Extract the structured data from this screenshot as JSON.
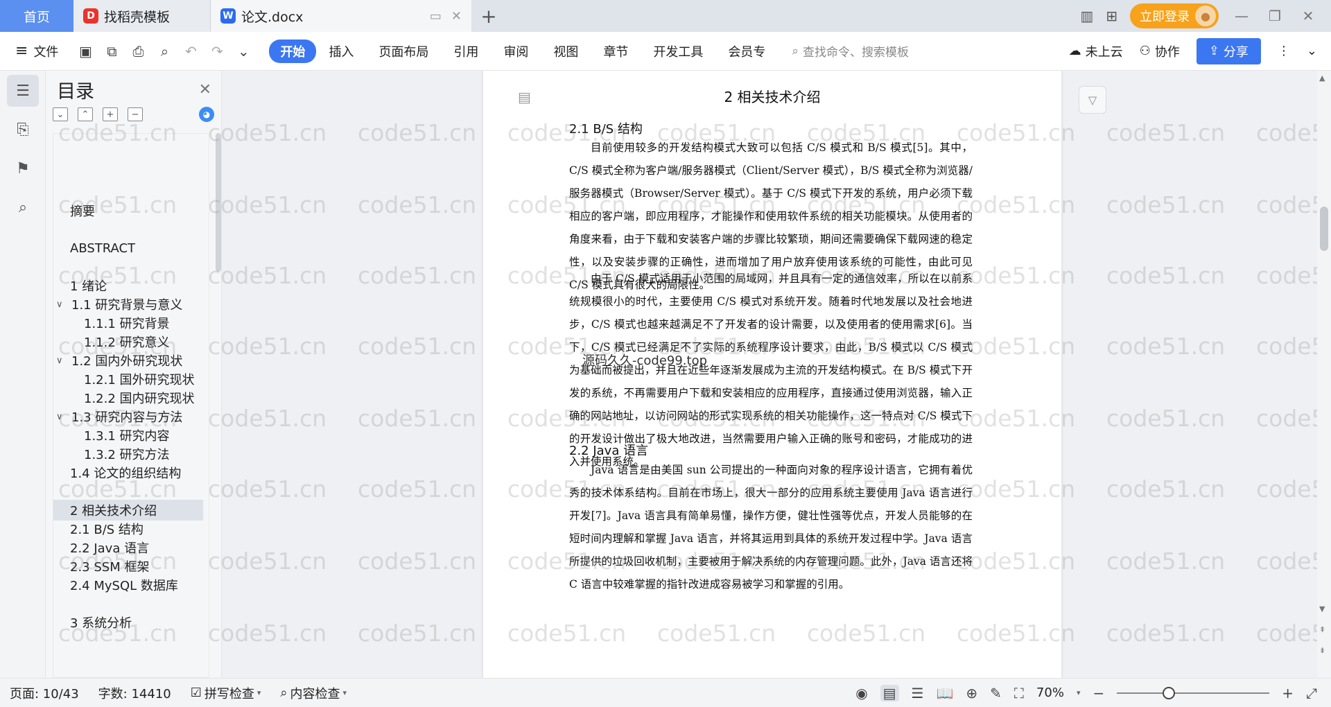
{
  "titlebar": {
    "home_tab": "首页",
    "tabs": [
      {
        "label": "找稻壳模板",
        "icon": "docer-logo-icon"
      },
      {
        "label": "论文.docx",
        "icon": "wps-writer-logo-icon"
      }
    ],
    "new_tab": "+",
    "login_label": "立即登录"
  },
  "ribbon": {
    "file_label": "文件",
    "menu": [
      "开始",
      "插入",
      "页面布局",
      "引用",
      "审阅",
      "视图",
      "章节",
      "开发工具",
      "会员专"
    ],
    "active_menu": "开始",
    "search_placeholder": "查找命令、搜索模板",
    "cloud_label": "未上云",
    "collab_label": "协作",
    "share_label": "分享"
  },
  "toc": {
    "title": "目录",
    "items": [
      {
        "label": "摘要",
        "level": 0
      },
      {
        "label": "ABSTRACT",
        "level": 0
      },
      {
        "label": "1 绪论",
        "level": 0
      },
      {
        "label": "1.1 研究背景与意义",
        "level": 1,
        "expanded": true
      },
      {
        "label": "1.1.1 研究背景",
        "level": 2
      },
      {
        "label": "1.1.2 研究意义",
        "level": 2
      },
      {
        "label": "1.2 国内外研究现状",
        "level": 1,
        "expanded": true
      },
      {
        "label": "1.2.1 国外研究现状",
        "level": 2
      },
      {
        "label": "1.2.2 国内研究现状",
        "level": 2
      },
      {
        "label": "1.3 研究内容与方法",
        "level": 1,
        "expanded": true
      },
      {
        "label": "1.3.1 研究内容",
        "level": 2
      },
      {
        "label": "1.3.2 研究方法",
        "level": 2
      },
      {
        "label": "1.4 论文的组织结构",
        "level": 0
      },
      {
        "label": "2 相关技术介绍",
        "level": 0,
        "selected": true
      },
      {
        "label": "2.1 B/S 结构",
        "level": 0
      },
      {
        "label": "2.2 Java 语言",
        "level": 0
      },
      {
        "label": "2.3 SSM 框架",
        "level": 0
      },
      {
        "label": "2.4 MySQL 数据库",
        "level": 0
      },
      {
        "label": "3 系统分析",
        "level": 0
      }
    ]
  },
  "document": {
    "chapter_title": "2 相关技术介绍",
    "sections": [
      {
        "heading": "2.1  B/S 结构",
        "paragraphs": [
          "目前使用较多的开发结构模式大致可以包括 C/S 模式和 B/S 模式[5]。其中，C/S 模式全称为客户端/服务器模式（Client/Server 模式），B/S 模式全称为浏览器/服务器模式（Browser/Server 模式）。基于 C/S 模式下开发的系统，用户必须下载相应的客户端，即应用程序，才能操作和使用软件系统的相关功能模块。从使用者的角度来看，由于下载和安装客户端的步骤比较繁琐，期间还需要确保下载网速的稳定性，以及安装步骤的正确性，进而增加了用户放弃使用该系统的可能性，由此可见 C/S 模式具有很大的局限性。",
          "由于 C/S 模式适用于小范围的局域网，并且具有一定的通信效率，所以在以前系统规模很小的时代，主要使用 C/S 模式对系统开发。随着时代地发展以及社会地进步，C/S 模式也越来越满足不了开发者的设计需要，以及使用者的使用需求[6]。当下，C/S 模式已经满足不了实际的系统程序设计要求，由此，B/S 模式以 C/S 模式为基础而被提出，并且在近些年逐渐发展成为主流的开发结构模式。在 B/S 模式下开发的系统，不再需要用户下载和安装相应的应用程序，直接通过使用浏览器，输入正确的网站地址，以访问网站的形式实现系统的相关功能操作，这一特点对 C/S 模式下的开发设计做出了极大地改进，当然需要用户输入正确的账号和密码，才能成功的进入并使用系统。"
        ]
      },
      {
        "heading": "2.2  Java 语言",
        "paragraphs": [
          "Java 语言是由美国 sun 公司提出的一种面向对象的程序设计语言，它拥有着优秀的技术体系结构。目前在市场上，很大一部分的应用系统主要使用 Java 语言进行开发[7]。Java 语言具有简单易懂，操作方便，健壮性强等优点，开发人员能够的在短时间内理解和掌握 Java 语言，并将其运用到具体的系统开发过程中学。Java 语言所提供的垃圾回收机制，主要被用于解决系统的内存管理问题。此外，Java 语言还将 C 语言中较难掌握的指针改进成容易被学习和掌握的引用。"
        ]
      }
    ],
    "overlay_text": "源码久久-code99.top",
    "watermark_text": "code51.cn"
  },
  "status": {
    "page_label": "页面: 10/43",
    "word_label": "字数: 14410",
    "spell_label": "拼写检查",
    "content_label": "内容检查",
    "zoom_label": "70%",
    "zoom_level": 0.3
  },
  "colors": {
    "accent": "#3c77f2",
    "home_tab": "#5b8ff0",
    "login": "#f7a21a"
  }
}
